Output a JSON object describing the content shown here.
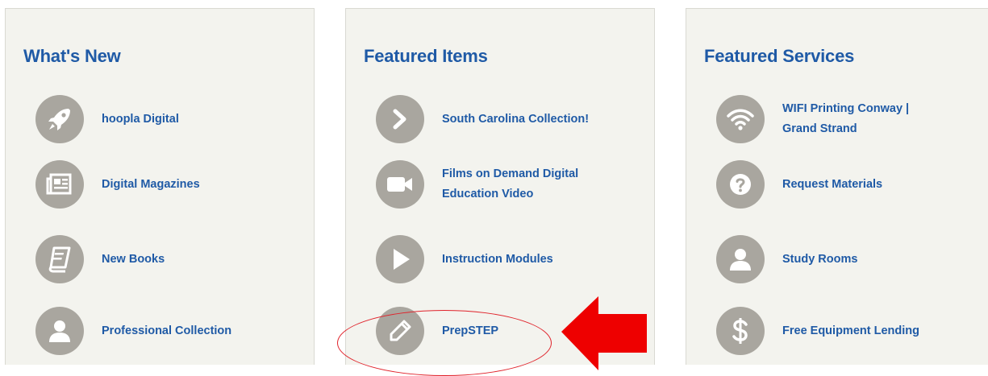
{
  "columns": [
    {
      "title": "What's New",
      "items": [
        {
          "label": "hoopla Digital",
          "icon": "rocket-icon"
        },
        {
          "label": "Digital Magazines",
          "icon": "newspaper-icon"
        },
        {
          "label": "New Books",
          "icon": "book-icon"
        },
        {
          "label": "Professional Collection",
          "icon": "user-icon"
        }
      ]
    },
    {
      "title": "Featured Items",
      "items": [
        {
          "label": "South Carolina Collection!",
          "icon": "chevron-right-icon"
        },
        {
          "label": "Films on Demand Digital Education Video",
          "icon": "video-camera-icon"
        },
        {
          "label": "Instruction Modules",
          "icon": "play-icon"
        },
        {
          "label": "PrepSTEP",
          "icon": "pencil-icon"
        }
      ]
    },
    {
      "title": "Featured Services",
      "items": [
        {
          "label": "WIFI Printing Conway | Grand Strand",
          "icon": "wifi-icon"
        },
        {
          "label": "Request Materials",
          "icon": "question-circle-icon"
        },
        {
          "label": "Study Rooms",
          "icon": "user-icon"
        },
        {
          "label": "Free Equipment Lending",
          "icon": "dollar-icon"
        }
      ]
    }
  ],
  "colors": {
    "heading": "#1f5aa6",
    "panel_bg": "#f3f3ee",
    "icon_circle": "#a9a69f",
    "annotation": "#e0232b"
  },
  "annotation": {
    "highlighted_item": "PrepSTEP",
    "marks": [
      "ellipse",
      "arrow"
    ]
  }
}
